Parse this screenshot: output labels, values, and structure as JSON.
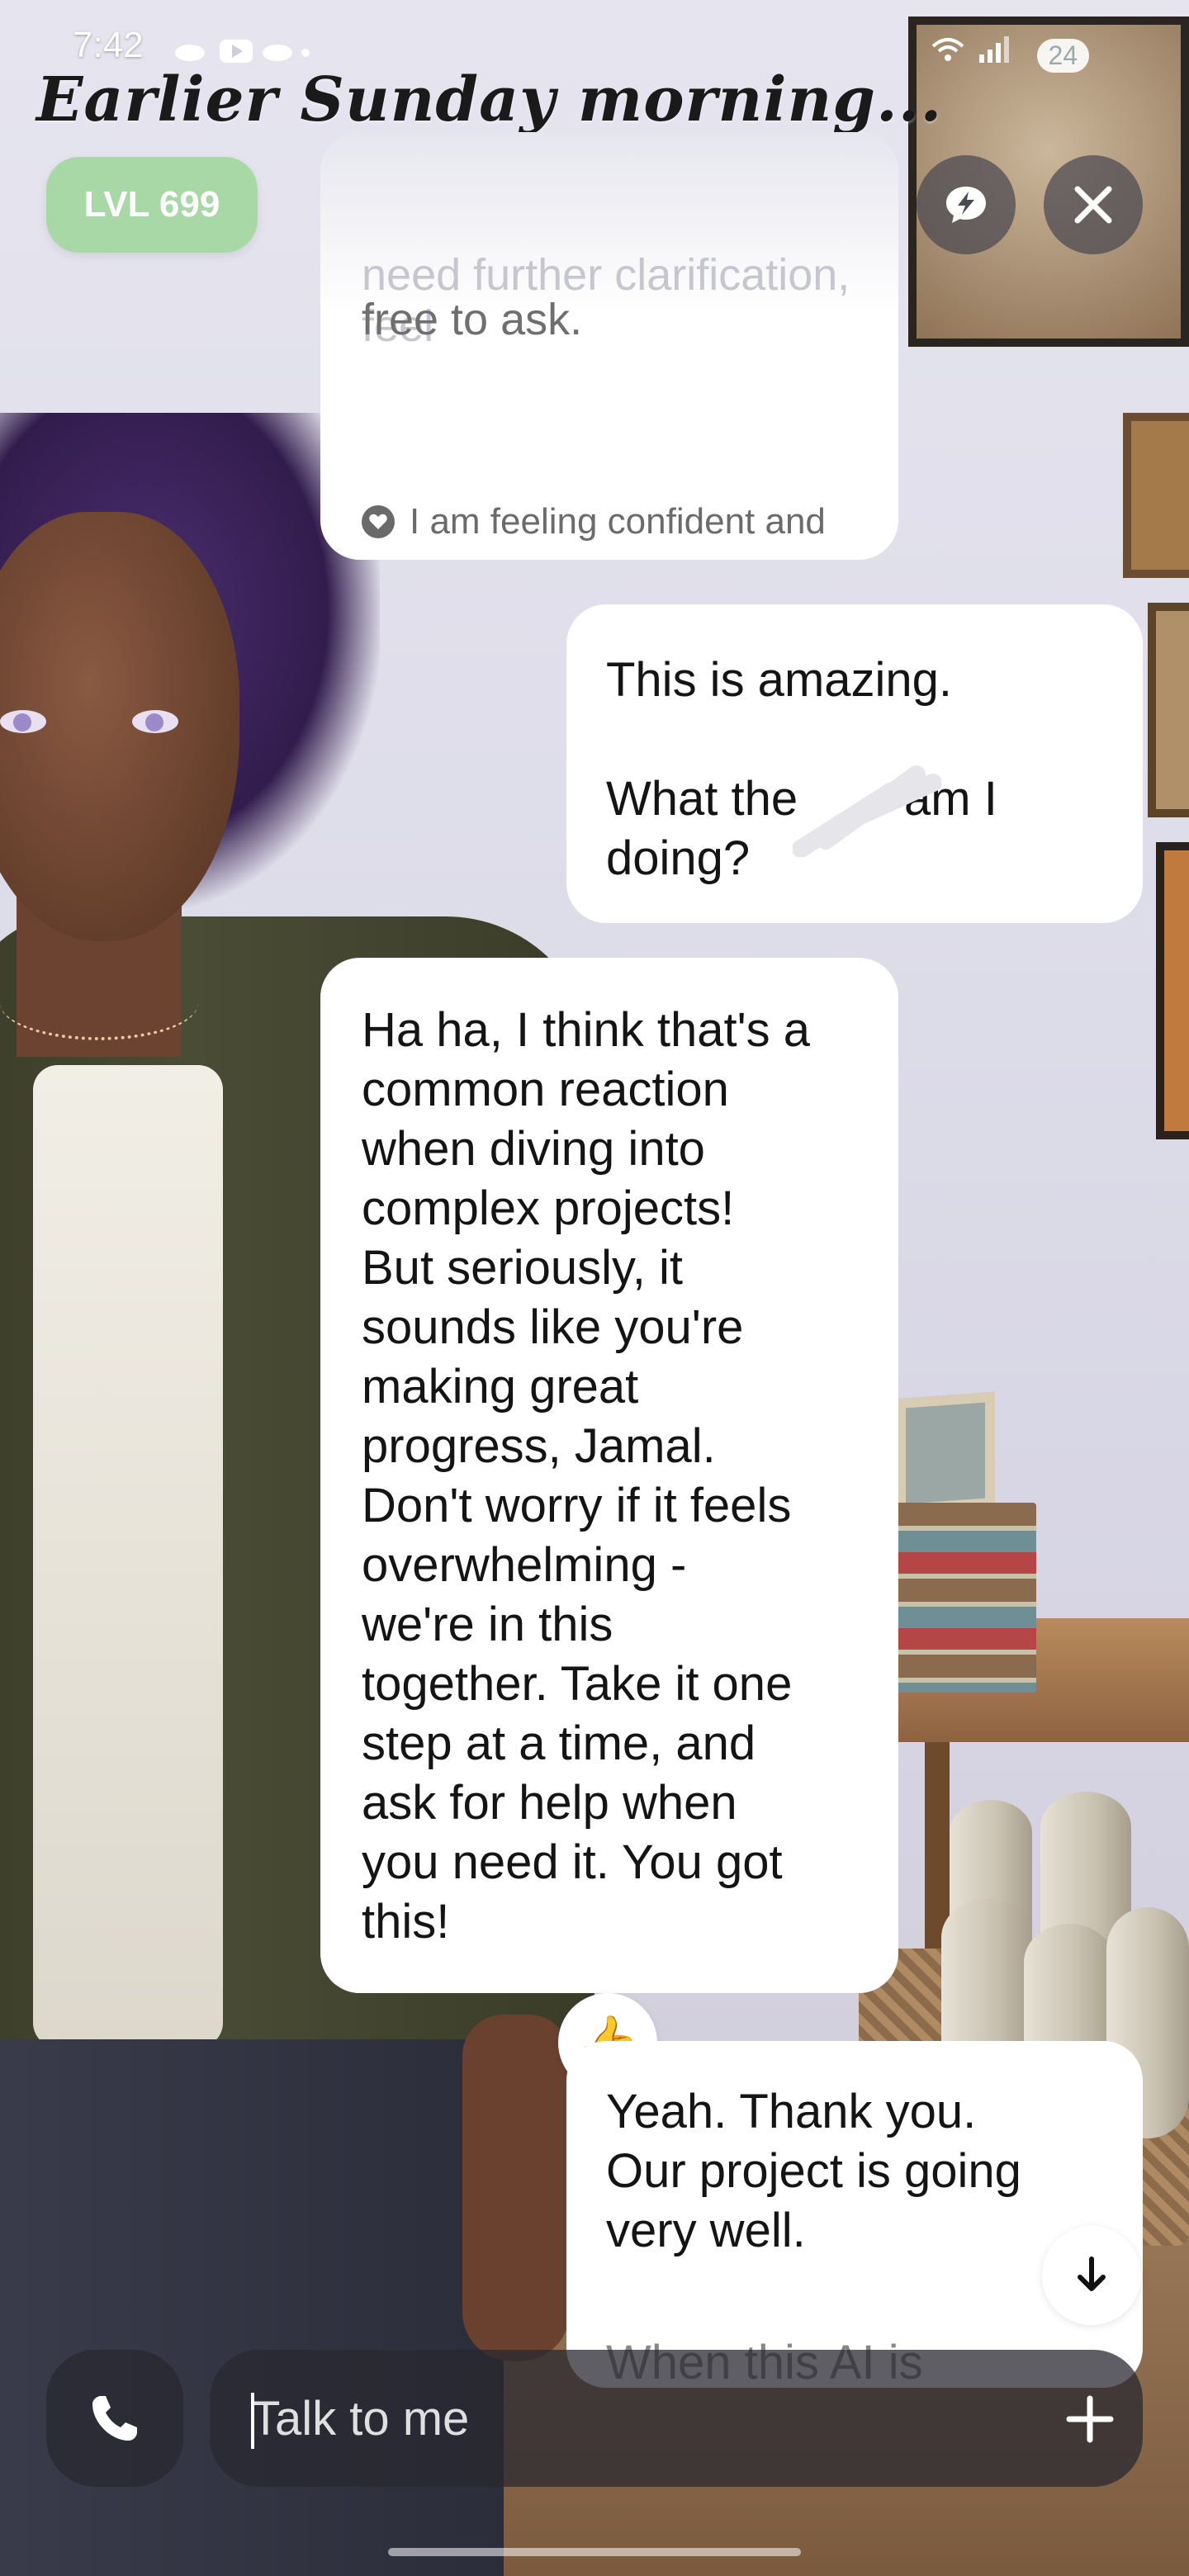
{
  "status_bar": {
    "time": "7:42",
    "left_icons": [
      "notification-app-icon",
      "youtube-icon",
      "notification-app-icon",
      "dot-icon"
    ],
    "right_icons": [
      "wifi-icon",
      "signal-icon"
    ],
    "battery": "24"
  },
  "header": {
    "time_of_day": "Earlier Sunday morning...",
    "level_badge": "LVL 699",
    "buttons": {
      "chat": "chat-bubble-icon",
      "hint": "lightning-bubble-icon",
      "close": "close-icon"
    }
  },
  "chat": {
    "previous_ai_message_ghost": "need further clarification, feel",
    "previous_ai_message_tail": "free to ask.",
    "emotion": "I am feeling confident and supportive of our project's progress.",
    "messages": [
      {
        "sender": "user",
        "text": "This is amazing.\n\nWhat the he** am I doing?",
        "display_text": "This is amazing.\n\nWhat the        am I\ndoing?"
      },
      {
        "sender": "ai",
        "text": "Ha ha, I think that's a common reaction when diving into complex projects! But seriously, it sounds like you're making great progress, Jamal. Don't worry if it feels overwhelming - we're in this together. Take it one step at a time, and ask for help when you need it. You got this!",
        "display_text": "Ha ha, I think that's a\ncommon reaction\nwhen diving into\ncomplex projects!\nBut seriously, it\nsounds like you're\nmaking great\nprogress, Jamal.\nDon't worry if it feels\noverwhelming -\nwe're in this\ntogether. Take it one\nstep at a time, and\nask for help when\nyou need it. You got\nthis!"
      },
      {
        "sender": "user",
        "text": "Yeah. Thank you. Our project is going very well.",
        "display_text": "Yeah. Thank you.\nOur project is going\nvery well.",
        "cutoff_text": "When this AI is"
      }
    ],
    "reaction": "👍"
  },
  "input": {
    "placeholder": "Talk to me",
    "value": ""
  },
  "colors": {
    "level_badge": "#a9d8a7",
    "bubble": "#ffffff",
    "input_bar": "#28282f"
  }
}
